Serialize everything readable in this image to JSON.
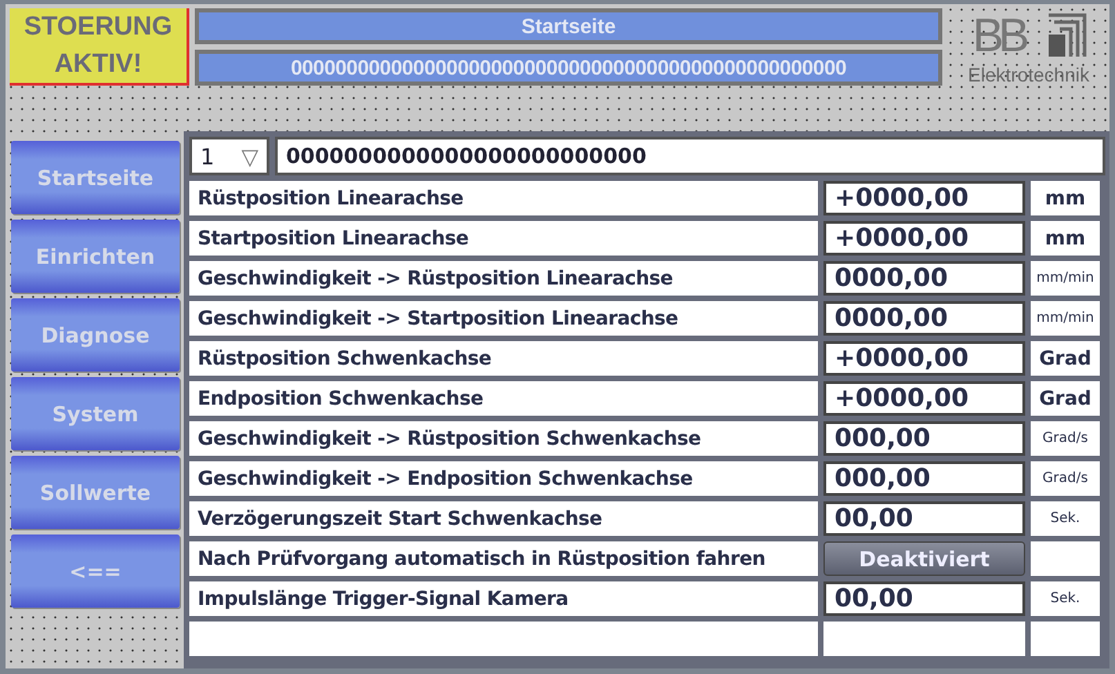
{
  "alarm": {
    "text": "STOERUNG AKTIV!"
  },
  "title_bar": {
    "title": "Startseite",
    "message": "00000000000000000000000000000000000000000000000000"
  },
  "logo": {
    "letters": "BB",
    "caption": "Elektrotechnik"
  },
  "nav": [
    {
      "label": "Startseite"
    },
    {
      "label": "Einrichten"
    },
    {
      "label": "Diagnose"
    },
    {
      "label": "System"
    },
    {
      "label": "Sollwerte"
    },
    {
      "label": "<=="
    }
  ],
  "selector": {
    "value": "1",
    "caret": "▽",
    "name": "0000000000000000000000000"
  },
  "rows": [
    {
      "kind": "value",
      "label": "Rüstposition Linearachse",
      "value": "+0000,00",
      "unit": "mm",
      "unit_bold": true
    },
    {
      "kind": "value",
      "label": "Startposition Linearachse",
      "value": "+0000,00",
      "unit": "mm",
      "unit_bold": true
    },
    {
      "kind": "value",
      "label": "Geschwindigkeit -> Rüstposition Linearachse",
      "value": "0000,00",
      "unit": "mm/min",
      "unit_bold": false
    },
    {
      "kind": "value",
      "label": "Geschwindigkeit -> Startposition Linearachse",
      "value": "0000,00",
      "unit": "mm/min",
      "unit_bold": false
    },
    {
      "kind": "value",
      "label": "Rüstposition Schwenkachse",
      "value": "+0000,00",
      "unit": "Grad",
      "unit_bold": true
    },
    {
      "kind": "value",
      "label": "Endposition Schwenkachse",
      "value": "+0000,00",
      "unit": "Grad",
      "unit_bold": true
    },
    {
      "kind": "value",
      "label": "Geschwindigkeit -> Rüstposition Schwenkachse",
      "value": "000,00",
      "unit": "Grad/s",
      "unit_bold": false
    },
    {
      "kind": "value",
      "label": "Geschwindigkeit -> Endposition Schwenkachse",
      "value": "000,00",
      "unit": "Grad/s",
      "unit_bold": false
    },
    {
      "kind": "value",
      "label": "Verzögerungszeit Start Schwenkachse",
      "value": "00,00",
      "unit": "Sek.",
      "unit_bold": false
    },
    {
      "kind": "toggle",
      "label": "Nach Prüfvorgang automatisch in Rüstposition fahren",
      "value": "Deaktiviert"
    },
    {
      "kind": "value",
      "label": "Impulslänge Trigger-Signal Kamera",
      "value": "00,00",
      "unit": "Sek.",
      "unit_bold": false
    }
  ]
}
